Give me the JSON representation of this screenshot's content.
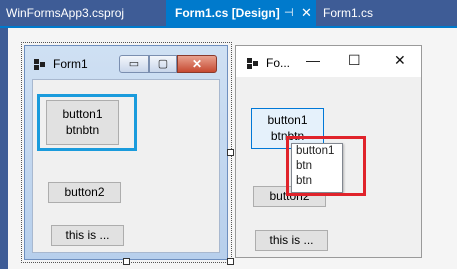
{
  "tabs": [
    {
      "label": "WinFormsApp3.csproj",
      "active": false
    },
    {
      "label": "Form1.cs [Design]",
      "active": true,
      "pin_icon": "pin-icon",
      "close_icon": "close-icon"
    },
    {
      "label": "Form1.cs",
      "active": false
    }
  ],
  "pin_glyph": "⊣",
  "close_glyph": "✕",
  "designer_form": {
    "title": "Form1",
    "buttons": [
      {
        "label": "button1\nbtnbtn"
      },
      {
        "label": "button2"
      },
      {
        "label": "this is ..."
      }
    ],
    "controls": {
      "minimize": "▭",
      "maximize": "▢",
      "close": "✕"
    }
  },
  "runtime_form": {
    "title": "Fo...",
    "controls": {
      "minimize": "—",
      "maximize": "☐",
      "close": "✕"
    },
    "buttons": [
      {
        "label": "button1\nbtnbtn"
      },
      {
        "label": "button2"
      },
      {
        "label": "this is ..."
      }
    ],
    "dropdown_items": [
      "button1",
      "btn",
      "btn"
    ]
  },
  "colors": {
    "tab_strip": "#3e5c96",
    "tab_active": "#007acc",
    "highlight_blue": "#1a9bdc",
    "highlight_red": "#e0232b"
  }
}
